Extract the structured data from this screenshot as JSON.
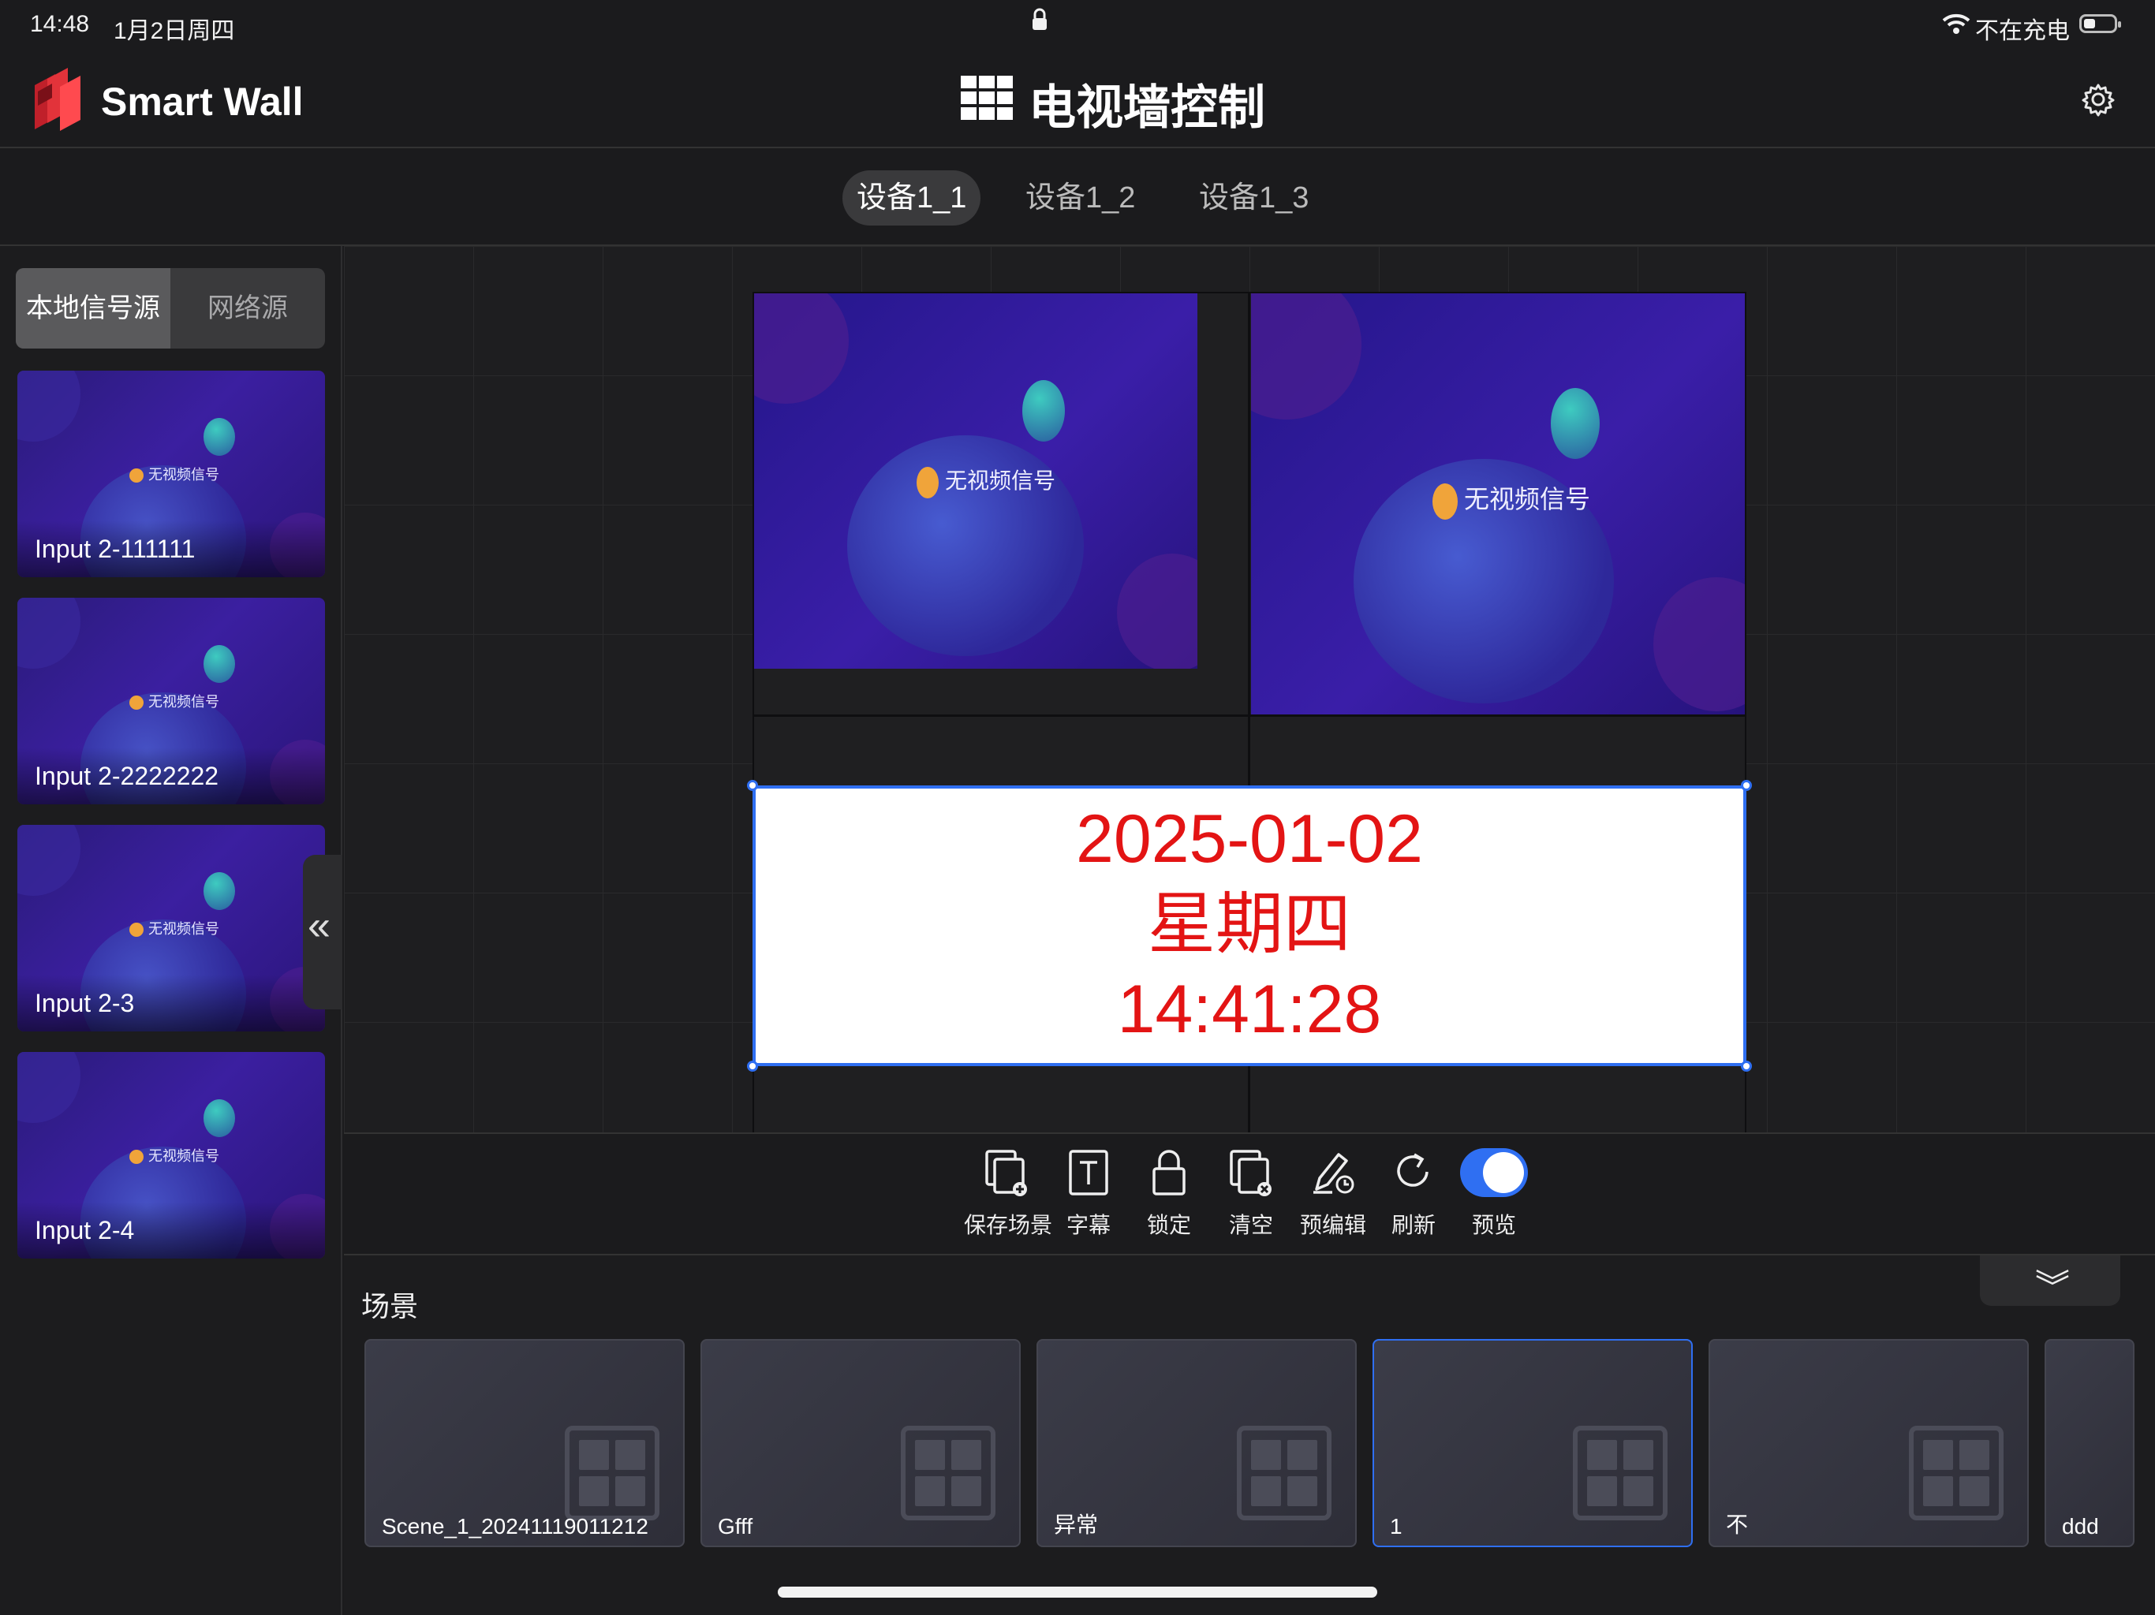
{
  "status_bar": {
    "time": "14:48",
    "date": "1月2日周四",
    "charging": "不在充电"
  },
  "header": {
    "app_name": "Smart Wall",
    "title": "电视墙控制"
  },
  "device_tabs": [
    "设备1_1",
    "设备1_2",
    "设备1_3"
  ],
  "source_tabs": {
    "local": "本地信号源",
    "network": "网络源"
  },
  "no_signal_text": "无视频信号",
  "sources": [
    "Input 2-111111",
    "Input 2-2222222",
    "Input 2-3",
    "Input 2-4"
  ],
  "clock": {
    "date": "2025-01-02",
    "weekday": "星期四",
    "time": "14:41:28"
  },
  "toolbar": {
    "save_scene": "保存场景",
    "subtitle": "字幕",
    "lock": "锁定",
    "clear": "清空",
    "pre_edit": "预编辑",
    "refresh": "刷新",
    "preview": "预览",
    "preview_on": true
  },
  "scenes": {
    "title": "场景",
    "items": [
      "Scene_1_20241119011212",
      "Gfff",
      "异常",
      "1",
      "不",
      "ddd"
    ],
    "selected_index": 3
  },
  "colors": {
    "accent": "#2f6ff2",
    "clock_text": "#e31414",
    "no_signal_dot": "#f0a43a"
  }
}
